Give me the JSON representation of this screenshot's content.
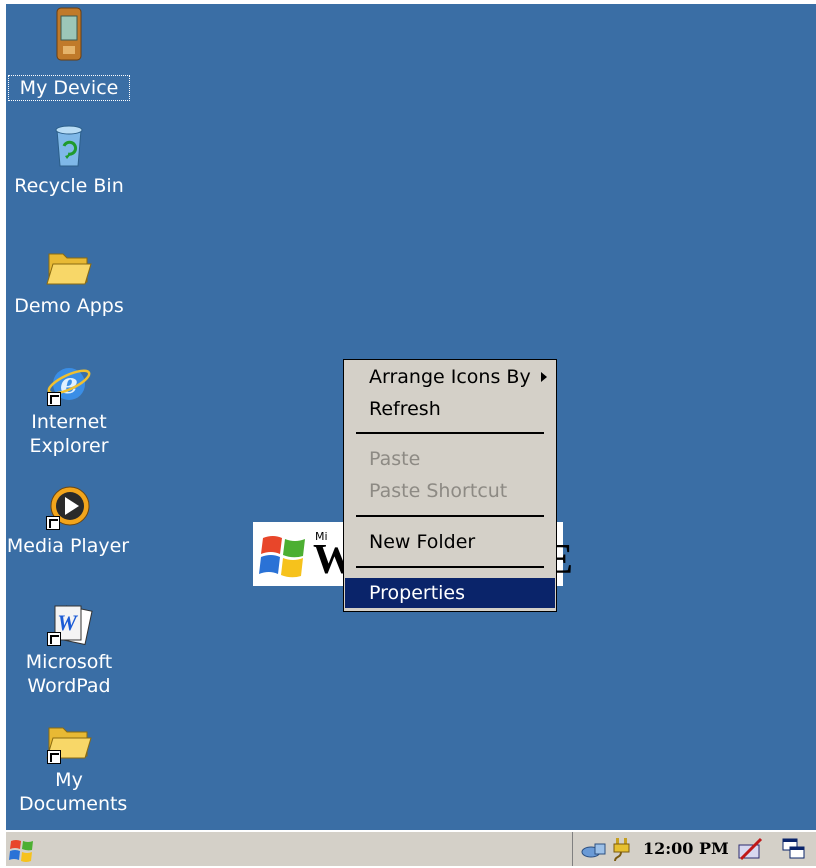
{
  "desktop": {
    "background_color": "#3a6ea5",
    "icons": [
      {
        "label": "My Device",
        "icon": "pda-device-icon"
      },
      {
        "label": "Recycle Bin",
        "icon": "recycle-bin-icon"
      },
      {
        "label": "Demo Apps",
        "icon": "folder-icon"
      },
      {
        "label": "Internet Explorer",
        "icon": "internet-explorer-icon"
      },
      {
        "label": "Media Player",
        "icon": "media-player-icon"
      },
      {
        "label": "Microsoft WordPad",
        "icon": "wordpad-icon"
      },
      {
        "label": "My Documents",
        "icon": "folder-icon"
      }
    ],
    "wallpaper": {
      "ms_text": "Mi",
      "big_text": "W",
      "end_text": "E"
    }
  },
  "context_menu": {
    "items": [
      {
        "label": "Arrange Icons By",
        "enabled": true,
        "submenu": true
      },
      {
        "label": "Refresh",
        "enabled": true
      },
      {
        "label": "Paste",
        "enabled": false
      },
      {
        "label": "Paste Shortcut",
        "enabled": false
      },
      {
        "label": "New Folder",
        "enabled": true
      },
      {
        "label": "Properties",
        "enabled": true,
        "highlighted": true
      }
    ],
    "highlight_color": "#0a246a"
  },
  "taskbar": {
    "clock": "12:00 PM",
    "tray_icons": [
      "network-icon",
      "power-plug-icon",
      "input-panel-icon",
      "desktop-switch-icon"
    ]
  }
}
